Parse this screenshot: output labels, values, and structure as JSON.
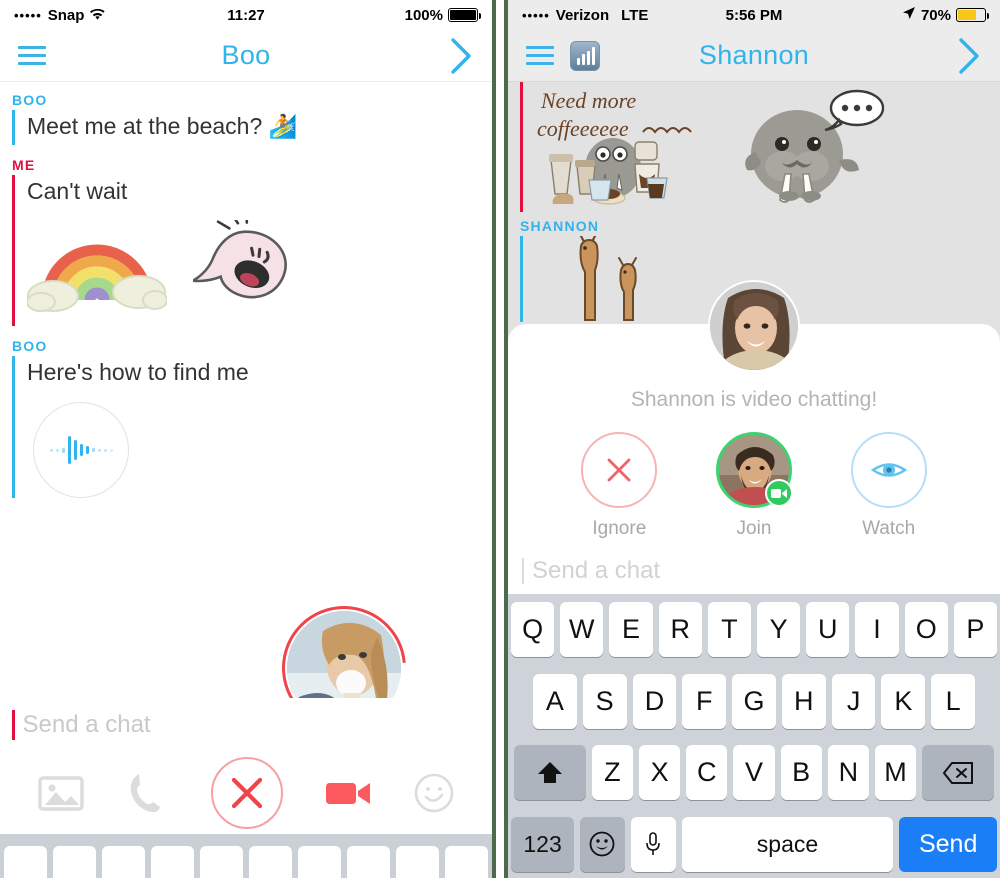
{
  "left_phone": {
    "status_bar": {
      "signal_dots": "•••••",
      "carrier": "Snap",
      "wifi_icon": "wifi-icon",
      "time": "11:27",
      "battery_percent": "100%",
      "battery_level": 100,
      "battery_color": "#000000"
    },
    "nav": {
      "menu_icon": "hamburger-icon",
      "title": "Boo",
      "forward_icon": "chevron-right-icon",
      "accent_color": "#31b3ec"
    },
    "messages": [
      {
        "sender": "BOO",
        "sender_color": "#31b3ec",
        "type": "text",
        "text": "Meet me at the beach? 🏄"
      },
      {
        "sender": "ME",
        "sender_color": "#e3103f",
        "type": "text",
        "text": "Can't wait"
      },
      {
        "sender": "ME",
        "sender_color": "#e3103f",
        "type": "sticker",
        "stickers": [
          "rainbow-cloud-sticker",
          "happy-blob-ghost-sticker"
        ]
      },
      {
        "sender": "BOO",
        "sender_color": "#31b3ec",
        "type": "text",
        "text": "Here's how to find me"
      },
      {
        "sender": "BOO",
        "sender_color": "#31b3ec",
        "type": "audio",
        "audio_icon": "audio-waveform-icon"
      }
    ],
    "selfie_bubble": {
      "name": "incoming-video-selfie",
      "ring_color": "#f0434a"
    },
    "input": {
      "placeholder": "Send a chat",
      "caret_color": "#e3103f"
    },
    "toolbar": [
      {
        "name": "photo-gallery-icon",
        "label": "Gallery"
      },
      {
        "name": "voice-call-icon",
        "label": "Call"
      },
      {
        "name": "cancel-call-icon",
        "label": "Cancel",
        "color": "#f0434a"
      },
      {
        "name": "video-camera-icon",
        "label": "Video",
        "color": "#fd5a5f"
      },
      {
        "name": "sticker-smiley-icon",
        "label": "Stickers"
      }
    ],
    "keyboard_keys_visible": 10
  },
  "right_phone": {
    "status_bar": {
      "signal_dots": "•••••",
      "carrier": "Verizon",
      "network": "LTE",
      "time": "5:56 PM",
      "location_icon": "location-arrow-icon",
      "battery_percent": "70%",
      "battery_level": 70,
      "battery_color": "#f8c617"
    },
    "nav": {
      "menu_icon": "hamburger-icon",
      "score_icon": "snapscore-bar-chart-icon",
      "title": "Shannon",
      "forward_icon": "chevron-right-icon",
      "accent_color": "#31b3ec"
    },
    "messages": [
      {
        "sender": "",
        "sender_color": "#e3103f",
        "type": "sticker",
        "stickers": [
          "need-more-coffee-walrus-sticker",
          "walrus-thinking-sticker"
        ]
      },
      {
        "sender": "SHANNON",
        "sender_color": "#31b3ec",
        "type": "sticker",
        "stickers": [
          "two-giraffes-sticker"
        ]
      }
    ],
    "video_chat_card": {
      "avatar": "shannon-avatar",
      "status_text": "Shannon is video chatting!",
      "actions": [
        {
          "name": "ignore-button",
          "label": "Ignore",
          "icon": "x-icon",
          "color": "#f7b3b5"
        },
        {
          "name": "join-button",
          "label": "Join",
          "icon": "join-avatar",
          "badge_icon": "video-camera-badge-icon",
          "color": "#3ed36f"
        },
        {
          "name": "watch-button",
          "label": "Watch",
          "icon": "eye-icon",
          "color": "#b4dff5"
        }
      ]
    },
    "input": {
      "placeholder": "Send a chat"
    },
    "keyboard": {
      "row1": [
        "Q",
        "W",
        "E",
        "R",
        "T",
        "Y",
        "U",
        "I",
        "O",
        "P"
      ],
      "row2": [
        "A",
        "S",
        "D",
        "F",
        "G",
        "H",
        "J",
        "K",
        "L"
      ],
      "row3_shift": "shift-icon",
      "row3": [
        "Z",
        "X",
        "C",
        "V",
        "B",
        "N",
        "M"
      ],
      "row3_backspace": "backspace-icon",
      "numbers_key": "123",
      "emoji_key": "emoji-smiley-icon",
      "dictation_key": "microphone-icon",
      "space_key": "space",
      "send_key": "Send",
      "send_color": "#1a7ef7"
    }
  },
  "divider_color": "#4c6b4c"
}
